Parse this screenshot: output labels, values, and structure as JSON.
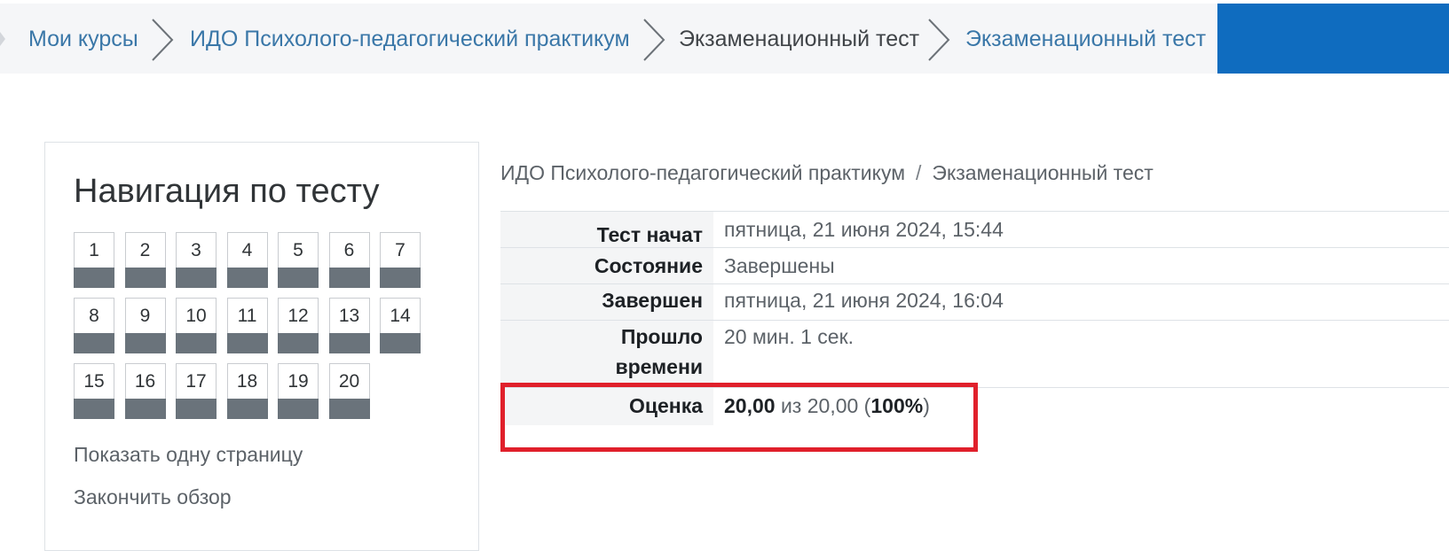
{
  "breadcrumb": [
    {
      "label": "Мои курсы",
      "type": "link"
    },
    {
      "label": "ИДО Психолого-педагогический практикум",
      "type": "link"
    },
    {
      "label": "Экзаменационный тест",
      "type": "plain"
    },
    {
      "label": "Экзаменационный тест",
      "type": "link"
    }
  ],
  "colors": {
    "accent": "#0f6cbf",
    "highlight": "#e0202b",
    "answered_bar": "#6a737b"
  },
  "navigation": {
    "title": "Навигация по тесту",
    "questions": [
      "1",
      "2",
      "3",
      "4",
      "5",
      "6",
      "7",
      "8",
      "9",
      "10",
      "11",
      "12",
      "13",
      "14",
      "15",
      "16",
      "17",
      "18",
      "19",
      "20"
    ],
    "show_one_page": "Показать одну страницу",
    "finish_review": "Закончить обзор"
  },
  "page_breadcrumb": {
    "course": "ИДО Психолого-педагогический практикум",
    "separator": "/",
    "quiz": "Экзаменационный тест"
  },
  "summary": {
    "started_label": "Тест начат",
    "started_value": "пятница, 21 июня 2024, 15:44",
    "state_label": "Состояние",
    "state_value": "Завершены",
    "completed_label": "Завершен",
    "completed_value": "пятница, 21 июня 2024, 16:04",
    "elapsed_label_1": "Прошло",
    "elapsed_label_2": "времени",
    "elapsed_value": "20 мин. 1 сек.",
    "grade_label": "Оценка",
    "grade_score": "20,00",
    "grade_of": "из 20,00",
    "grade_percent": "100%"
  }
}
